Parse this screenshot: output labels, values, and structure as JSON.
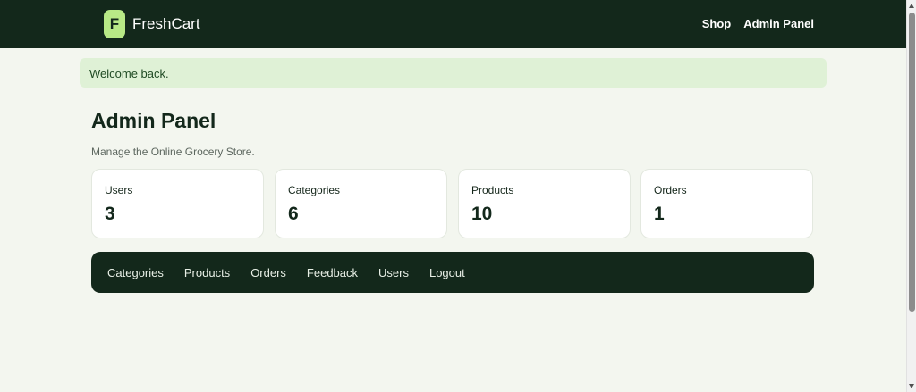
{
  "header": {
    "logo_letter": "F",
    "brand_name": "FreshCart",
    "nav": [
      {
        "label": "Shop"
      },
      {
        "label": "Admin Panel"
      }
    ]
  },
  "alert": {
    "message": "Welcome back."
  },
  "main": {
    "title": "Admin Panel",
    "subtitle": "Manage the Online Grocery Store.",
    "stats": [
      {
        "label": "Users",
        "value": "3"
      },
      {
        "label": "Categories",
        "value": "6"
      },
      {
        "label": "Products",
        "value": "10"
      },
      {
        "label": "Orders",
        "value": "1"
      }
    ],
    "admin_nav": [
      {
        "label": "Categories"
      },
      {
        "label": "Products"
      },
      {
        "label": "Orders"
      },
      {
        "label": "Feedback"
      },
      {
        "label": "Users"
      },
      {
        "label": "Logout"
      }
    ]
  },
  "colors": {
    "header_bg": "#13281b",
    "logo_bg": "#b8e986",
    "page_bg": "#f3f6ef",
    "alert_bg": "#dff1d6"
  }
}
